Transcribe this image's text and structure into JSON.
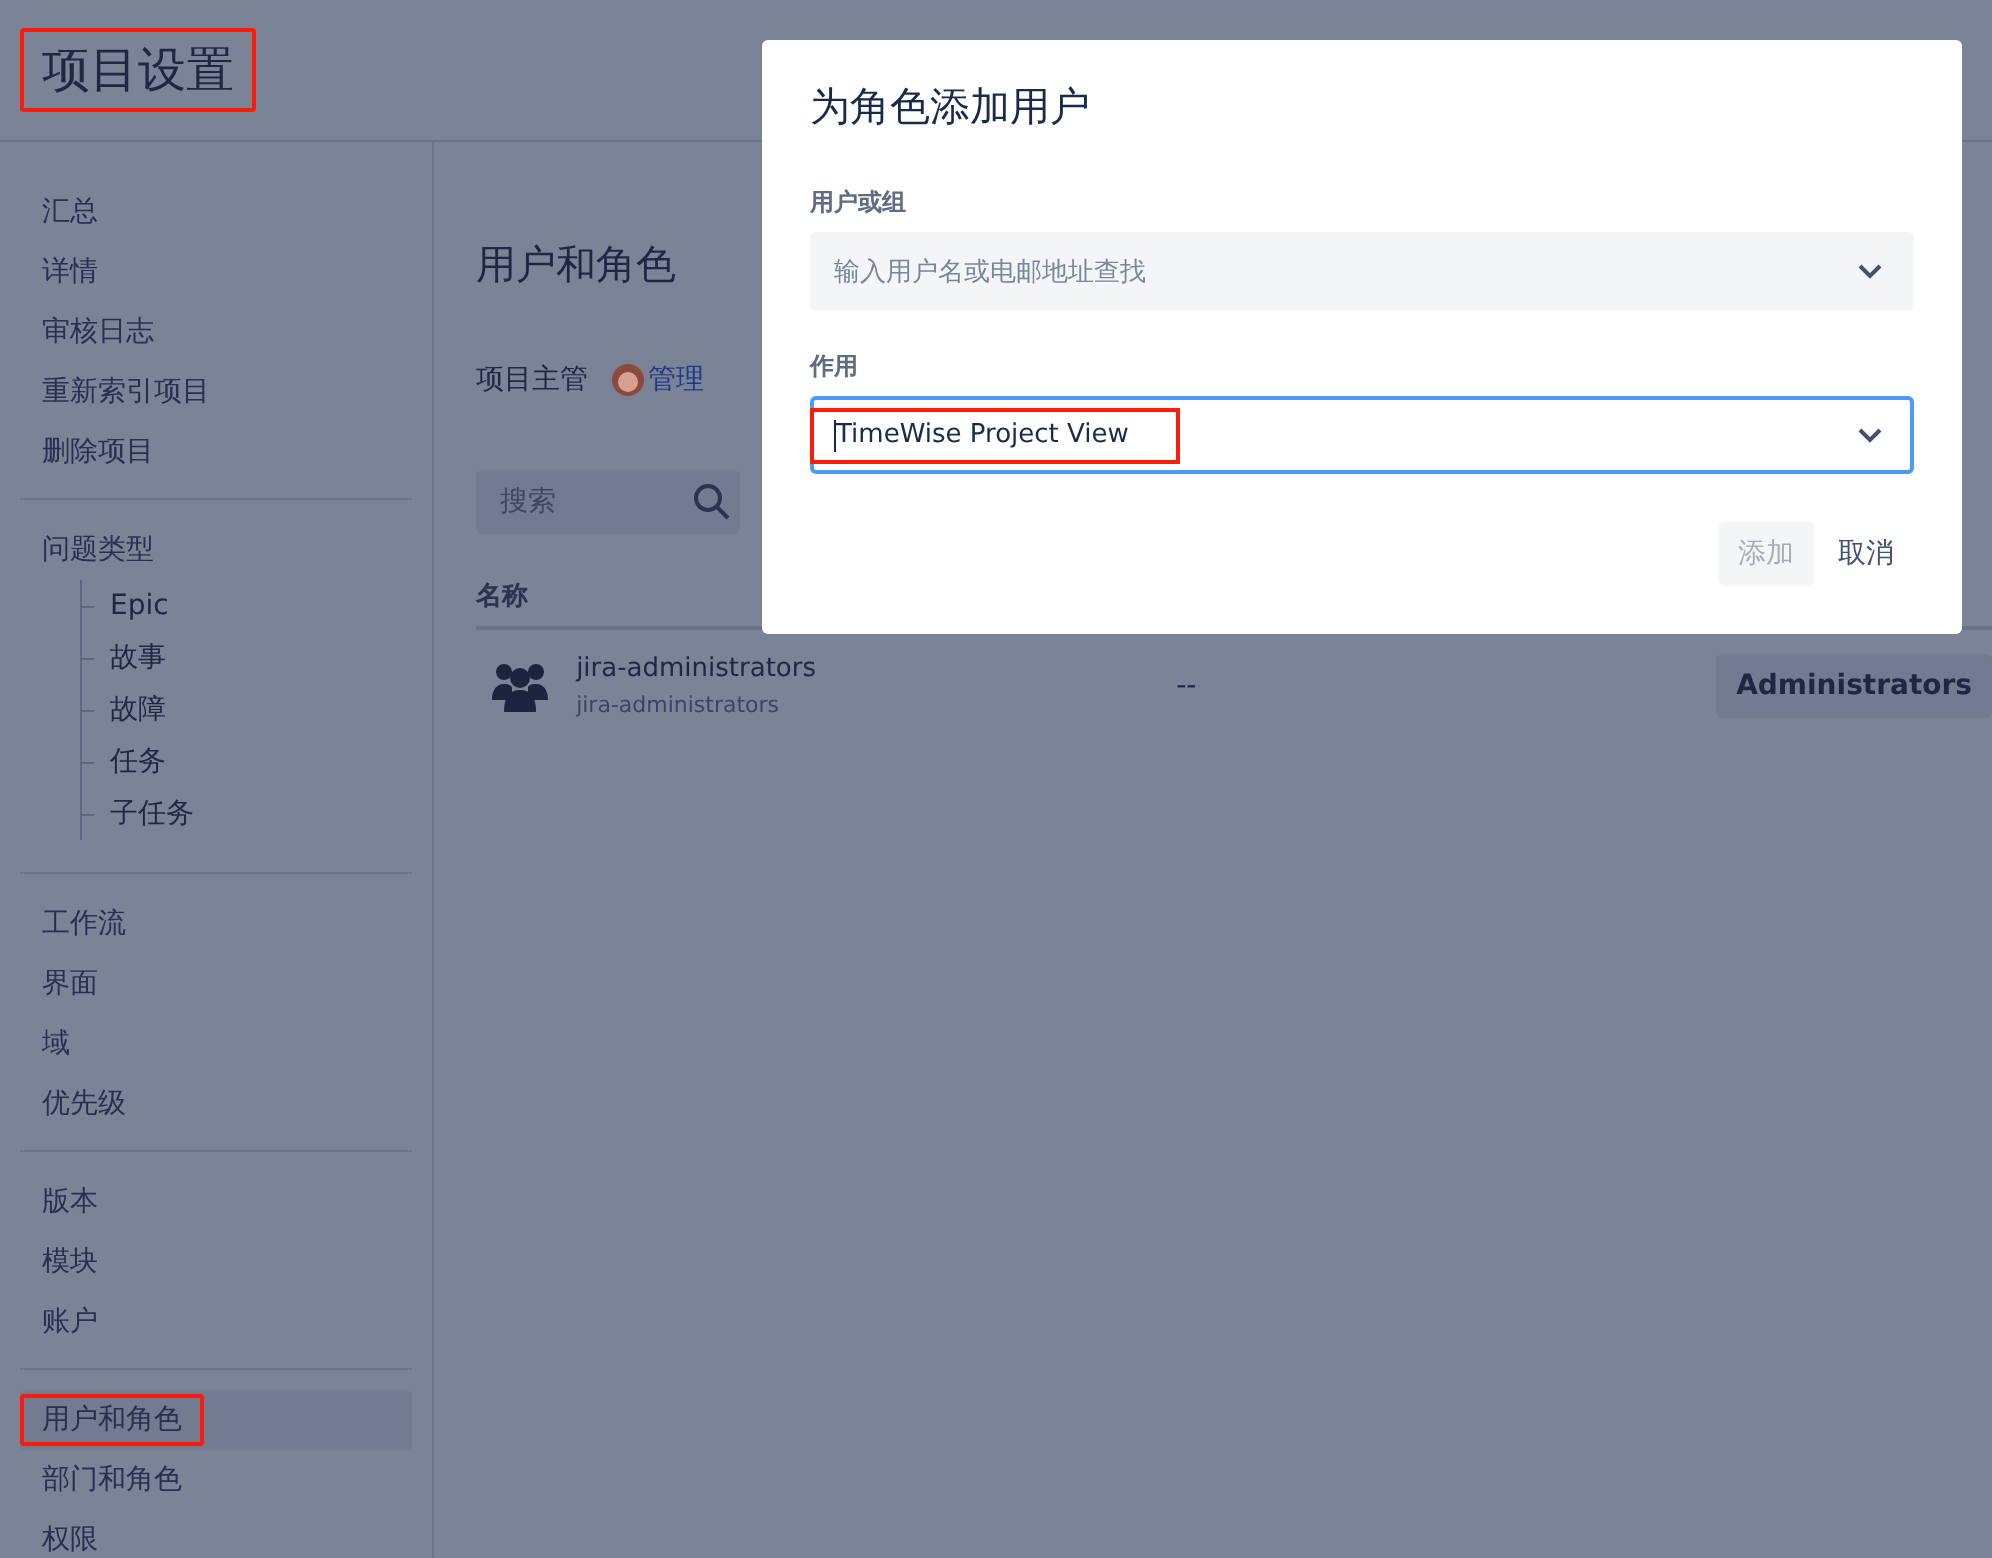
{
  "header": {
    "title": "项目设置",
    "highlighted": true
  },
  "sidebar": {
    "groups": [
      {
        "items": [
          {
            "label": "汇总",
            "selected": false,
            "highlighted": false
          },
          {
            "label": "详情",
            "selected": false,
            "highlighted": false
          },
          {
            "label": "审核日志",
            "selected": false,
            "highlighted": false
          },
          {
            "label": "重新索引项目",
            "selected": false,
            "highlighted": false
          },
          {
            "label": "删除项目",
            "selected": false,
            "highlighted": false
          }
        ]
      },
      {
        "items": [
          {
            "label": "问题类型",
            "selected": false,
            "highlighted": false,
            "children": [
              {
                "label": "Epic"
              },
              {
                "label": "故事"
              },
              {
                "label": "故障"
              },
              {
                "label": "任务"
              },
              {
                "label": "子任务"
              }
            ]
          }
        ]
      },
      {
        "items": [
          {
            "label": "工作流",
            "selected": false,
            "highlighted": false
          },
          {
            "label": "界面",
            "selected": false,
            "highlighted": false
          },
          {
            "label": "域",
            "selected": false,
            "highlighted": false
          },
          {
            "label": "优先级",
            "selected": false,
            "highlighted": false
          }
        ]
      },
      {
        "items": [
          {
            "label": "版本",
            "selected": false,
            "highlighted": false
          },
          {
            "label": "模块",
            "selected": false,
            "highlighted": false
          },
          {
            "label": "账户",
            "selected": false,
            "highlighted": false
          }
        ]
      },
      {
        "items": [
          {
            "label": "用户和角色",
            "selected": true,
            "highlighted": true
          },
          {
            "label": "部门和角色",
            "selected": false,
            "highlighted": false
          },
          {
            "label": "权限",
            "selected": false,
            "highlighted": false
          }
        ]
      }
    ]
  },
  "main": {
    "heading": "用户和角色",
    "lead_label": "项目主管",
    "lead_name": "管理",
    "search": {
      "placeholder": "搜索"
    },
    "table": {
      "columns": [
        "名称"
      ],
      "rows": [
        {
          "name": "jira-administrators",
          "sub": "jira-administrators",
          "column_2": "--",
          "role": "Administrators"
        }
      ]
    }
  },
  "dialog": {
    "title": "为角色添加用户",
    "user_field": {
      "label": "用户或组",
      "placeholder": "输入用户名或电邮地址查找"
    },
    "role_field": {
      "label": "作用",
      "value": "TimeWise Project View",
      "focused": true,
      "highlighted": true
    },
    "buttons": [
      {
        "label": "添加",
        "kind": "primary",
        "disabled": true
      },
      {
        "label": "取消",
        "kind": "link",
        "disabled": false
      }
    ]
  }
}
